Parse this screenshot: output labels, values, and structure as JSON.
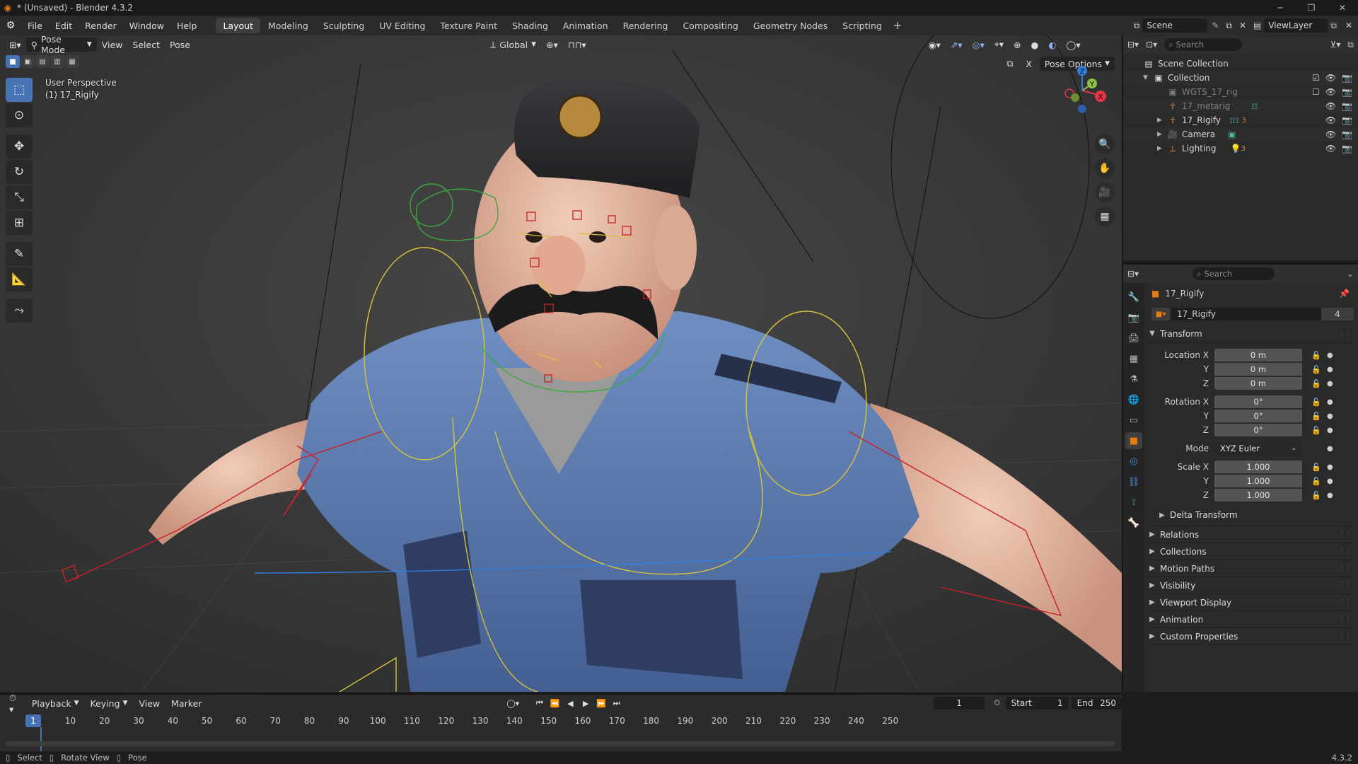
{
  "window": {
    "title": "* (Unsaved) - Blender 4.3.2"
  },
  "menu": {
    "items": [
      "File",
      "Edit",
      "Render",
      "Window",
      "Help"
    ],
    "workspaces": [
      "Layout",
      "Modeling",
      "Sculpting",
      "UV Editing",
      "Texture Paint",
      "Shading",
      "Animation",
      "Rendering",
      "Compositing",
      "Geometry Nodes",
      "Scripting"
    ],
    "active_workspace": "Layout",
    "scene": "Scene",
    "view_layer": "ViewLayer"
  },
  "viewport": {
    "mode": "Pose Mode",
    "menus": [
      "View",
      "Select",
      "Pose"
    ],
    "orientation": "Global",
    "pose_options": "Pose Options",
    "overlay_line1": "User Perspective",
    "overlay_line2": "(1) 17_Rigify",
    "gizmo_axes": [
      "X",
      "Y",
      "Z"
    ]
  },
  "outliner": {
    "search_placeholder": "Search",
    "rows": [
      {
        "label": "Scene Collection",
        "indent": 0,
        "icon": "scene-collection-icon"
      },
      {
        "label": "Collection",
        "indent": 1,
        "icon": "collection-icon"
      },
      {
        "label": "WGTS_17_rig",
        "indent": 2,
        "icon": "collection-icon",
        "dim": true
      },
      {
        "label": "17_metarig",
        "indent": 2,
        "icon": "armature-icon",
        "dim": true
      },
      {
        "label": "17_Rigify",
        "indent": 2,
        "icon": "armature-icon"
      },
      {
        "label": "Camera",
        "indent": 2,
        "icon": "camera-icon"
      },
      {
        "label": "Lighting",
        "indent": 2,
        "icon": "light-icon"
      }
    ],
    "badges": {
      "rigify_count": "3",
      "lighting_count": "3"
    }
  },
  "properties": {
    "search_placeholder": "Search",
    "object_name": "17_Rigify",
    "datablock_name": "17_Rigify",
    "datablock_users": "4",
    "transform_label": "Transform",
    "location": {
      "label": "Location X",
      "x": "0 m",
      "y": "0 m",
      "z": "0 m"
    },
    "rotation": {
      "label": "Rotation X",
      "x": "0°",
      "y": "0°",
      "z": "0°"
    },
    "mode": {
      "label": "Mode",
      "value": "XYZ Euler"
    },
    "scale": {
      "label": "Scale X",
      "x": "1.000",
      "y": "1.000",
      "z": "1.000"
    },
    "axis_y": "Y",
    "axis_z": "Z",
    "delta_transform": "Delta Transform",
    "panels": [
      "Relations",
      "Collections",
      "Motion Paths",
      "Visibility",
      "Viewport Display",
      "Animation",
      "Custom Properties"
    ]
  },
  "timeline": {
    "menus": [
      "Playback",
      "Keying",
      "View",
      "Marker"
    ],
    "current_frame": "1",
    "start_label": "Start",
    "start": "1",
    "end_label": "End",
    "end": "250",
    "ticks": [
      "10",
      "20",
      "30",
      "40",
      "50",
      "60",
      "70",
      "80",
      "90",
      "100",
      "110",
      "120",
      "130",
      "140",
      "150",
      "160",
      "170",
      "180",
      "190",
      "200",
      "210",
      "220",
      "230",
      "240",
      "250"
    ]
  },
  "status": {
    "items": [
      "Select",
      "Rotate View",
      "Pose"
    ],
    "version": "4.3.2"
  },
  "colors": {
    "accent": "#4772b3",
    "x_axis": "#e53448",
    "y_axis": "#8bc34a",
    "z_axis": "#2f7fe0",
    "bone_yellow": "#d8c43a",
    "bone_red": "#c8202a",
    "bone_green": "#3da83d"
  }
}
